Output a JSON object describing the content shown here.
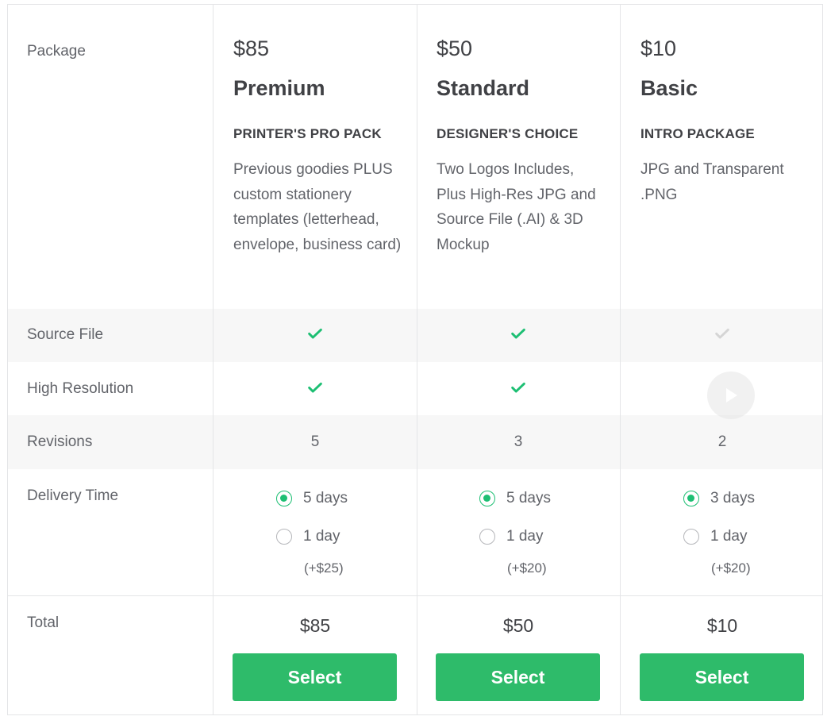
{
  "rows": {
    "package": "Package",
    "source_file": "Source File",
    "high_resolution": "High Resolution",
    "revisions": "Revisions",
    "delivery_time": "Delivery Time",
    "total": "Total"
  },
  "packages": [
    {
      "price": "$85",
      "name": "Premium",
      "tagline": "PRINTER'S PRO PACK",
      "description": "Previous goodies PLUS custom stationery templates (letterhead, envelope, business card)",
      "source_file": true,
      "high_resolution": true,
      "revisions": "5",
      "delivery_options": [
        {
          "label": "5 days",
          "selected": true
        },
        {
          "label": "1 day",
          "selected": false
        }
      ],
      "express_extra": "(+$25)",
      "total": "$85",
      "select_label": "Select"
    },
    {
      "price": "$50",
      "name": "Standard",
      "tagline": "DESIGNER'S CHOICE",
      "description": "Two Logos Includes, Plus High-Res JPG and Source File (.AI) & 3D Mockup",
      "source_file": true,
      "high_resolution": true,
      "revisions": "3",
      "delivery_options": [
        {
          "label": "5 days",
          "selected": true
        },
        {
          "label": "1 day",
          "selected": false
        }
      ],
      "express_extra": "(+$20)",
      "total": "$50",
      "select_label": "Select"
    },
    {
      "price": "$10",
      "name": "Basic",
      "tagline": "INTRO PACKAGE",
      "description": "JPG and Transparent .PNG",
      "source_file": false,
      "high_resolution": false,
      "revisions": "2",
      "delivery_options": [
        {
          "label": "3 days",
          "selected": true
        },
        {
          "label": "1 day",
          "selected": false
        }
      ],
      "express_extra": "(+$20)",
      "total": "$10",
      "select_label": "Select"
    }
  ],
  "icons": {
    "check": "check-icon",
    "check_disabled": "check-icon-disabled",
    "play": "play-icon"
  },
  "colors": {
    "accent": "#1dbf73",
    "button": "#2ebb6a",
    "check_disabled": "#d5d5d5",
    "row_alt": "#f7f7f7",
    "border": "#e4e5e7"
  }
}
